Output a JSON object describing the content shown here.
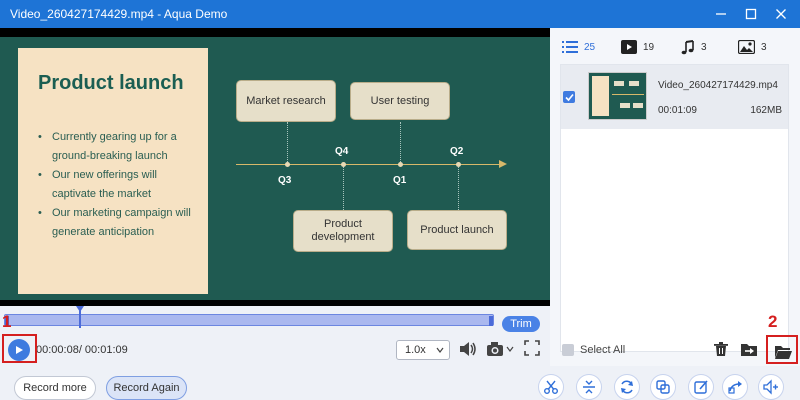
{
  "window": {
    "title": "Video_260427174429.mp4  -  Aqua Demo"
  },
  "slide": {
    "title": "Product launch",
    "bullets": [
      "Currently gearing up for a ground-breaking launch",
      "Our new offerings will captivate the market",
      "Our marketing campaign will generate anticipation"
    ],
    "quarters": [
      "Q3",
      "Q4",
      "Q1",
      "Q2"
    ],
    "boxes": [
      "Market research",
      "User testing",
      "Product development",
      "Product launch"
    ]
  },
  "player": {
    "trim_label": "Trim",
    "time": "00:00:08/ 00:01:09",
    "speed": "1.0x",
    "annotation_1": "1",
    "annotation_2": "2"
  },
  "bottom": {
    "record_more": "Record more",
    "record_again": "Record Again",
    "tools": [
      "scissors-icon",
      "split-icon",
      "refresh-icon",
      "copy-icon",
      "edit-icon",
      "share-icon",
      "volume-plus-icon"
    ]
  },
  "right_panel": {
    "tabs": [
      {
        "icon": "list-icon",
        "count": "25"
      },
      {
        "icon": "video-icon",
        "count": "19"
      },
      {
        "icon": "music-icon",
        "count": "3"
      },
      {
        "icon": "image-icon",
        "count": "3"
      }
    ],
    "file": {
      "name": "Video_260427174429.mp4",
      "duration": "00:01:09",
      "size": "162MB"
    },
    "select_all": "Select All"
  },
  "colors": {
    "titlebar": "#1e74d6",
    "accent": "#3e7bdf",
    "slide_bg": "#1f5a51",
    "slide_card": "#f6e2c3",
    "annotation": "#d51f1f"
  }
}
